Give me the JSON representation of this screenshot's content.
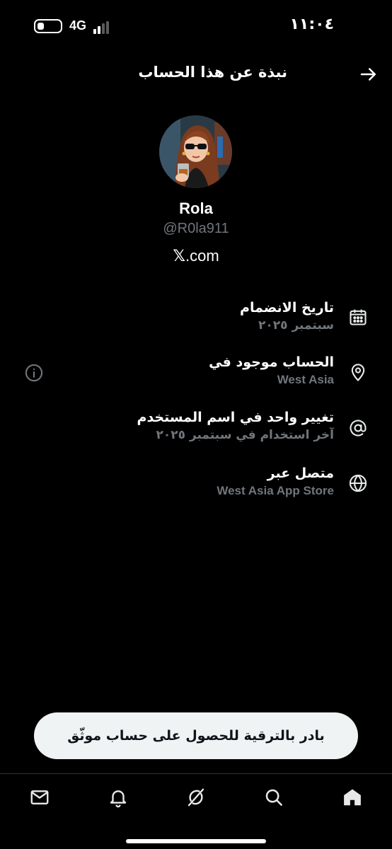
{
  "status_bar": {
    "time": "١١:٠٤",
    "network": "4G",
    "battery_level_percent": 30
  },
  "header": {
    "title": "نبذة عن هذا الحساب",
    "back_icon": "arrow-right-icon"
  },
  "profile": {
    "display_name": "Rola",
    "handle": "@R0la911",
    "website_prefix": "𝕏",
    "website_suffix": ".com",
    "avatar_icon": "avatar-image"
  },
  "info": {
    "joined": {
      "title": "تاريخ الانضمام",
      "value": "سبتمبر ٢٠٢٥",
      "icon": "calendar-icon"
    },
    "location": {
      "title": "الحساب موجود في",
      "value": "West Asia",
      "icon": "location-pin-icon",
      "details_icon": "info-circle-icon"
    },
    "username_changes": {
      "title": "تغيير واحد في اسم المستخدم",
      "value": "آخر استخدام في سبتمبر ٢٠٢٥",
      "icon": "at-sign-icon"
    },
    "connected_via": {
      "title": "متصل عبر",
      "value": "West Asia App Store",
      "icon": "globe-icon"
    }
  },
  "upgrade_button": {
    "label": "بادر بالترقية للحصول على حساب موثّق"
  },
  "bottom_nav": {
    "items": [
      "mail-icon",
      "bell-icon",
      "grok-icon",
      "search-icon",
      "home-icon"
    ],
    "active": "home-icon"
  },
  "colors": {
    "background": "#000000",
    "text_primary": "#ffffff",
    "text_secondary": "#71767b",
    "button_bg": "#eff3f4",
    "divider": "#2f3336"
  }
}
